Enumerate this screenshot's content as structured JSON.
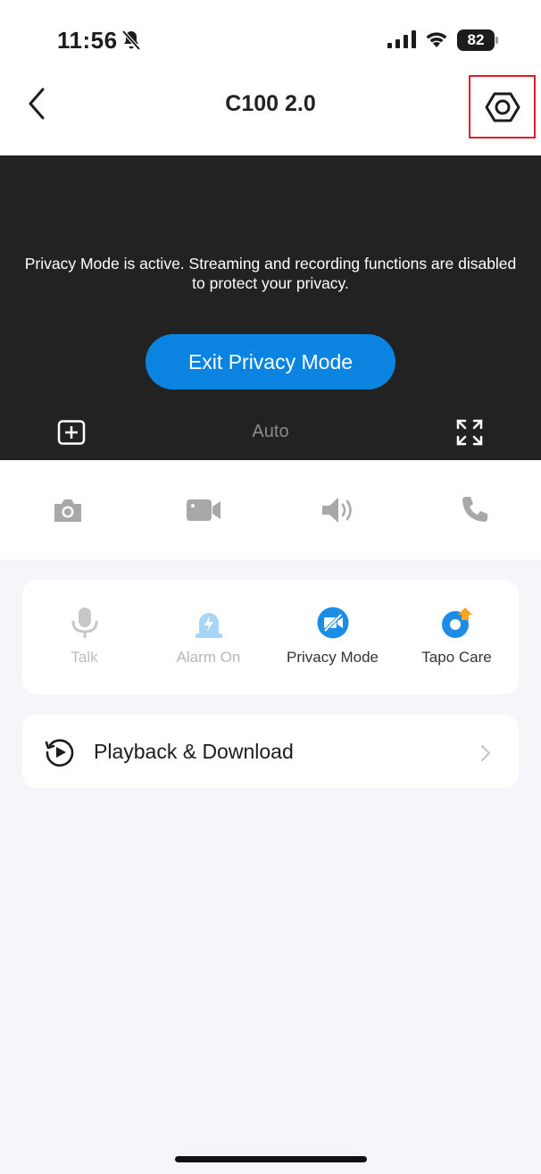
{
  "status_bar": {
    "time": "11:56",
    "battery": "82"
  },
  "header": {
    "title": "C100 2.0"
  },
  "video": {
    "privacy_message": "Privacy Mode is active. Streaming and recording functions are disabled to protect your privacy.",
    "exit_button": "Exit Privacy Mode",
    "quality": "Auto"
  },
  "features": [
    {
      "label": "Talk",
      "color": "#bdbdbd",
      "enabled": false
    },
    {
      "label": "Alarm On",
      "color": "#b7b7b7",
      "enabled": false
    },
    {
      "label": "Privacy Mode",
      "color": "#333333",
      "enabled": true
    },
    {
      "label": "Tapo Care",
      "color": "#333333",
      "enabled": true
    }
  ],
  "playback": {
    "label": "Playback & Download"
  },
  "colors": {
    "accent": "#0a84e0",
    "highlight_box": "#e11d2a",
    "tapo_care_badge": "#f5a623"
  }
}
